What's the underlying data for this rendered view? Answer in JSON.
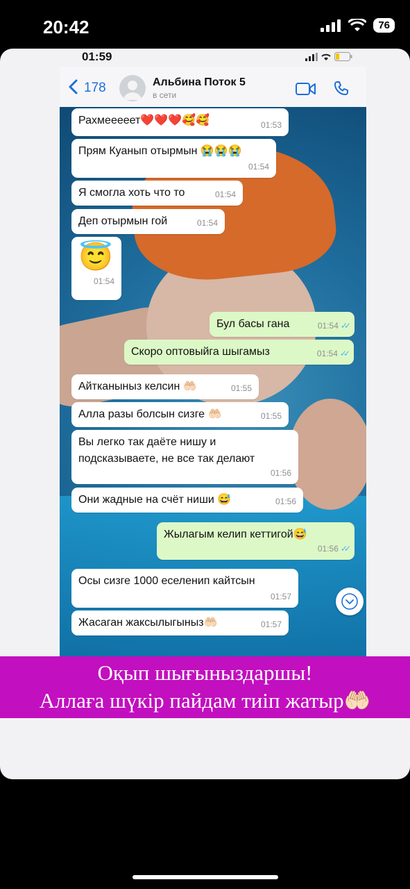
{
  "outer_status": {
    "time": "20:42",
    "battery": "76"
  },
  "inner_status": {
    "time": "01:59"
  },
  "header": {
    "back_count": "178",
    "contact_name": "Альбина Поток 5",
    "contact_status": "в сети"
  },
  "messages": [
    {
      "text": "Рахмееееет❤️❤️❤️🥰🥰",
      "time": "01:53",
      "direction": "incoming"
    },
    {
      "text": "Прям Куанып отырмын 😭😭😭",
      "time": "01:54",
      "direction": "incoming"
    },
    {
      "text": "Я смогла хоть что то",
      "time": "01:54",
      "direction": "incoming"
    },
    {
      "text": "Деп отырмын гой",
      "time": "01:54",
      "direction": "incoming"
    },
    {
      "text": "😇",
      "time": "01:54",
      "direction": "incoming"
    },
    {
      "text": "Бул басы гана",
      "time": "01:54",
      "direction": "outgoing"
    },
    {
      "text": "Скоро оптовыйга шыгамыз",
      "time": "01:54",
      "direction": "outgoing"
    },
    {
      "text": "Айтканыныз келсин 🤲🏻",
      "time": "01:55",
      "direction": "incoming"
    },
    {
      "text": "Алла разы болсын сизге 🤲🏻",
      "time": "01:55",
      "direction": "incoming"
    },
    {
      "text": "Вы легко так даёте нишу и\nподсказываете, не все так делают",
      "time": "01:56",
      "direction": "incoming"
    },
    {
      "text": "Они жадные на счёт ниши 😅",
      "time": "01:56",
      "direction": "incoming"
    },
    {
      "text": "Жылагым келип кеттигой😅",
      "time": "01:56",
      "direction": "outgoing"
    },
    {
      "text": "Осы сизге 1000 еселенип кайтсын",
      "time": "01:57",
      "direction": "incoming"
    },
    {
      "text": "Жасаган жаксылыгыныз🤲🏻",
      "time": "01:57",
      "direction": "incoming"
    }
  ],
  "banner": {
    "line1": "Оқып шығыныздаршы!",
    "line2": "Аллаға шүкір пайдам тиіп жатыр🤲🏻"
  },
  "colors": {
    "ios_blue": "#1e6fd8",
    "outgoing_bubble": "#dcf8c6",
    "incoming_bubble": "#ffffff",
    "banner": "#c20fbf",
    "read_ticks": "#4fb3f6"
  },
  "icons": [
    "signal-icon",
    "wifi-icon",
    "battery-icon",
    "back-chevron-icon",
    "avatar-icon",
    "video-call-icon",
    "phone-call-icon",
    "read-ticks-icon",
    "scroll-down-icon"
  ]
}
